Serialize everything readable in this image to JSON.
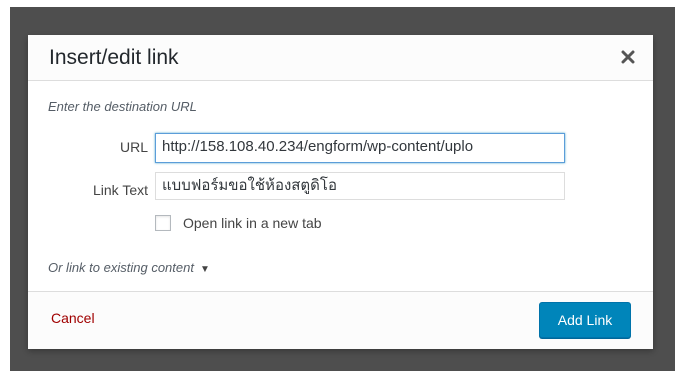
{
  "dialog": {
    "title": "Insert/edit link",
    "close_icon": "close-icon",
    "instructions": "Enter the destination URL",
    "url": {
      "label": "URL",
      "value": "http://158.108.40.234/engform/wp-content/uplo"
    },
    "link_text": {
      "label": "Link Text",
      "value": "แบบฟอร์มขอใช้ห้องสตูดิโอ"
    },
    "new_tab": {
      "label": "Open link in a new tab",
      "checked": false
    },
    "existing_content": {
      "label": "Or link to existing content",
      "icon": "triangle-down-icon"
    },
    "footer": {
      "cancel_label": "Cancel",
      "submit_label": "Add Link"
    }
  },
  "colors": {
    "primary_button": "#0085ba",
    "cancel_link": "#a00000",
    "backdrop": "#4e4e4e",
    "focus_border": "#5b9dd9"
  }
}
